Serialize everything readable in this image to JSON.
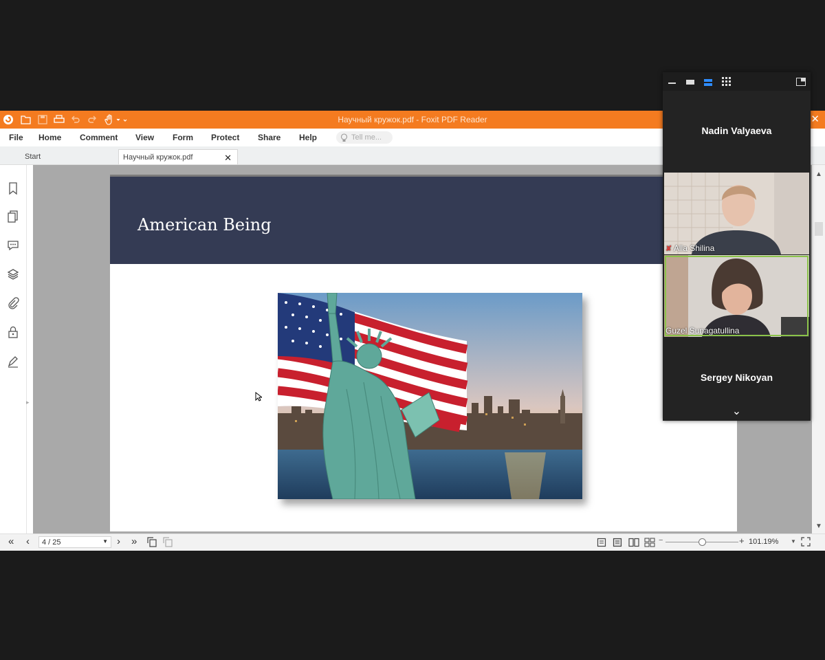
{
  "window": {
    "title": "Научный кружок.pdf - Foxit PDF Reader",
    "close_glyph": "✕"
  },
  "menu": {
    "items": [
      "File",
      "Home",
      "Comment",
      "View",
      "Form",
      "Protect",
      "Share",
      "Help"
    ],
    "tell_me_placeholder": "Tell me..."
  },
  "tabs": {
    "start": "Start",
    "document": "Научный кружок.pdf",
    "close_glyph": "✕"
  },
  "sidebar_icons": [
    "bookmark-icon",
    "pages-icon",
    "comments-icon",
    "layers-icon",
    "attachments-icon",
    "security-icon",
    "signature-icon"
  ],
  "slide": {
    "title": "American Being",
    "image": "statue-of-liberty-flag-new-york-skyline"
  },
  "statusbar": {
    "page": "4 / 25",
    "zoom": "101.19%",
    "zoom_level": 0.5
  },
  "zoom_panel": {
    "participants": [
      {
        "name": "Nadin Valyaeva",
        "video": false
      },
      {
        "name": "Alla Shilina",
        "video": true,
        "muted": true
      },
      {
        "name": "Guzel Sunagatullina",
        "video": true,
        "active_speaker": true
      },
      {
        "name": "Sergey Nikoyan",
        "video": false
      }
    ],
    "chevron": "⌄"
  },
  "colors": {
    "titlebar": "#f47b20",
    "slide_header": "#343b54",
    "active_speaker_border": "#8bc34a"
  }
}
